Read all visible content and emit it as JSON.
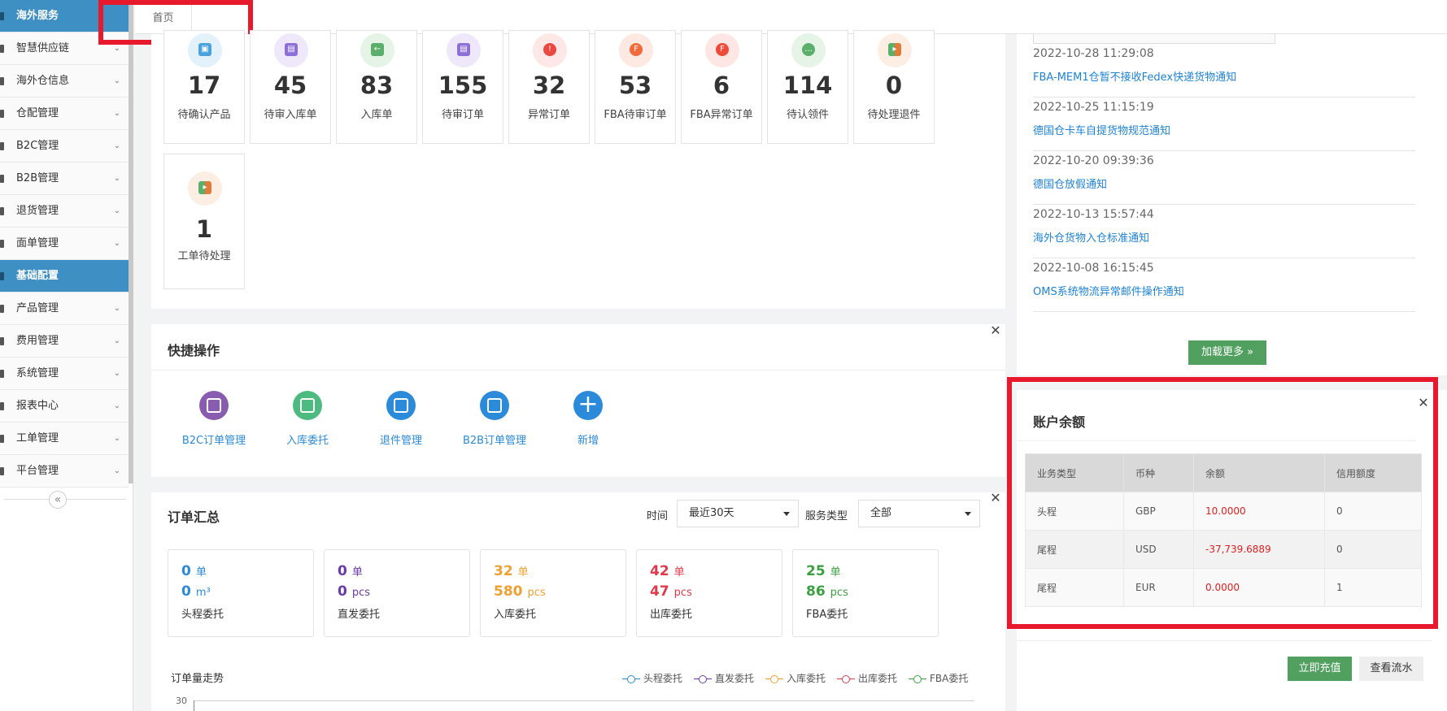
{
  "sidebar": {
    "items": [
      {
        "label": "海外服务",
        "active": true
      },
      {
        "label": "智慧供应链"
      },
      {
        "label": "海外仓信息"
      },
      {
        "label": "仓配管理"
      },
      {
        "label": "B2C管理"
      },
      {
        "label": "B2B管理"
      },
      {
        "label": "退货管理"
      },
      {
        "label": "面单管理"
      },
      {
        "label": "基础配置",
        "active": true
      },
      {
        "label": "产品管理"
      },
      {
        "label": "费用管理"
      },
      {
        "label": "系统管理"
      },
      {
        "label": "报表中心"
      },
      {
        "label": "工单管理"
      },
      {
        "label": "平台管理"
      }
    ],
    "collapse_icon": "«"
  },
  "tabs": [
    {
      "label": "首页"
    }
  ],
  "stats": [
    {
      "value": "17",
      "label": "待确认产品",
      "color": "#4aa3df"
    },
    {
      "value": "45",
      "label": "待审入库单",
      "color": "#8e6fd8"
    },
    {
      "value": "83",
      "label": "入库单",
      "color": "#5ab06a"
    },
    {
      "value": "155",
      "label": "待审订单",
      "color": "#8e6fd8"
    },
    {
      "value": "32",
      "label": "异常订单",
      "color": "#e9473f"
    },
    {
      "value": "53",
      "label": "FBA待审订单",
      "color": "#f06a3a"
    },
    {
      "value": "6",
      "label": "FBA异常订单",
      "color": "#f04a3a"
    },
    {
      "value": "114",
      "label": "待认领件",
      "color": "#5ab06a"
    },
    {
      "value": "0",
      "label": "待处理退件",
      "color": "#e07b3a"
    },
    {
      "value": "1",
      "label": "工单待处理",
      "color": "#e07b3a"
    }
  ],
  "quick_ops": {
    "title": "快捷操作",
    "items": [
      {
        "label": "B2C订单管理",
        "color": "#8a5cb0"
      },
      {
        "label": "入库委托",
        "color": "#4dbb7f"
      },
      {
        "label": "退件管理",
        "color": "#2b8ad9"
      },
      {
        "label": "B2B订单管理",
        "color": "#2b8ad9"
      },
      {
        "label": "新增",
        "color": "#2b8ad9"
      }
    ]
  },
  "order_summary": {
    "title": "订单汇总",
    "time_label": "时间",
    "time_value": "最近30天",
    "service_label": "服务类型",
    "service_value": "全部",
    "cards": [
      {
        "v1": "0",
        "u1": "单",
        "v2": "0",
        "u2": "m³",
        "label": "头程委托",
        "color": "#2b8ad9"
      },
      {
        "v1": "0",
        "u1": "单",
        "v2": "0",
        "u2": "pcs",
        "label": "直发委托",
        "color": "#6a3aa8"
      },
      {
        "v1": "32",
        "u1": "单",
        "v2": "580",
        "u2": "pcs",
        "label": "入库委托",
        "color": "#f0a030"
      },
      {
        "v1": "42",
        "u1": "单",
        "v2": "47",
        "u2": "pcs",
        "label": "出库委托",
        "color": "#e03a4a"
      },
      {
        "v1": "25",
        "u1": "单",
        "v2": "86",
        "u2": "pcs",
        "label": "FBA委托",
        "color": "#3aa040"
      }
    ],
    "trend_title": "订单量走势",
    "y_top": "30",
    "legend": [
      {
        "label": "头程委托",
        "color": "#2b8ad9"
      },
      {
        "label": "直发委托",
        "color": "#6a3aa8"
      },
      {
        "label": "入库委托",
        "color": "#f0a030"
      },
      {
        "label": "出库委托",
        "color": "#e03a4a"
      },
      {
        "label": "FBA委托",
        "color": "#3aa040"
      }
    ]
  },
  "notices": [
    {
      "date": "2022-10-28 11:29:08",
      "title": "FBA-MEM1仓暂不接收Fedex快递货物通知"
    },
    {
      "date": "2022-10-25 11:15:19",
      "title": "德国仓卡车自提货物规范通知"
    },
    {
      "date": "2022-10-20 09:39:36",
      "title": "德国仓放假通知"
    },
    {
      "date": "2022-10-13 15:57:44",
      "title": "海外仓货物入仓标准通知"
    },
    {
      "date": "2022-10-08 16:15:45",
      "title": "OMS系统物流异常邮件操作通知"
    }
  ],
  "load_more": "加载更多 »",
  "balance": {
    "title": "账户余额",
    "headers": [
      "业务类型",
      "币种",
      "余额",
      "信用额度"
    ],
    "rows": [
      [
        "头程",
        "GBP",
        "10.0000",
        "0"
      ],
      [
        "尾程",
        "USD",
        "-37,739.6889",
        "0"
      ],
      [
        "尾程",
        "EUR",
        "0.0000",
        "1"
      ]
    ],
    "recharge": "立即充值",
    "flow": "查看流水"
  }
}
